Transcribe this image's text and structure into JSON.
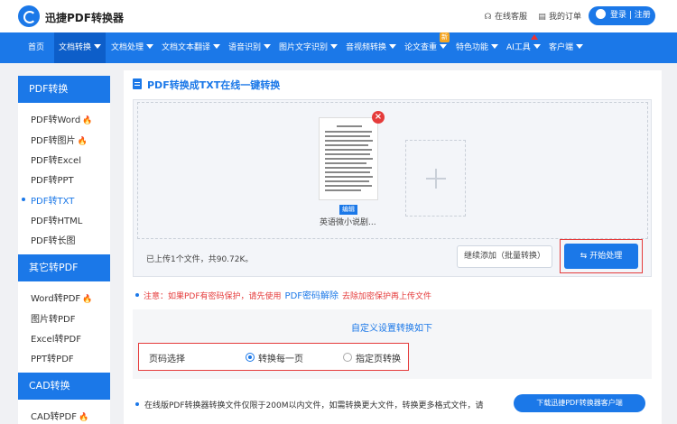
{
  "header": {
    "brand": "迅捷PDF转换器",
    "service_label": "在线客服",
    "orders_label": "我的订单",
    "login_label": "登录 | 注册"
  },
  "nav": {
    "items": [
      {
        "label": "首页"
      },
      {
        "label": "文档转换"
      },
      {
        "label": "文档处理"
      },
      {
        "label": "文档文本翻译"
      },
      {
        "label": "语音识别"
      },
      {
        "label": "图片文字识别"
      },
      {
        "label": "音视频转换"
      },
      {
        "label": "论文查重"
      },
      {
        "label": "特色功能"
      },
      {
        "label": "AI工具"
      },
      {
        "label": "客户端"
      }
    ],
    "new_badge": "新"
  },
  "sidebar": {
    "sections": [
      {
        "title": "PDF转换",
        "items": [
          "PDF转Word",
          "PDF转图片",
          "PDF转Excel",
          "PDF转PPT",
          "PDF转TXT",
          "PDF转HTML",
          "PDF转长图"
        ]
      },
      {
        "title": "其它转PDF",
        "items": [
          "Word转PDF",
          "图片转PDF",
          "Excel转PDF",
          "PPT转PDF"
        ]
      },
      {
        "title": "CAD转换",
        "items": [
          "CAD转PDF"
        ]
      }
    ]
  },
  "main": {
    "title": "PDF转换成TXT在线一键转换",
    "file": {
      "name": "英语微小说剧...",
      "edit_label": "编辑"
    },
    "upload_info": "已上传1个文件，共90.72K。",
    "add_more_label": "继续添加（批量转换）",
    "start_label": "开始处理",
    "note": {
      "prefix": "注意：如果PDF有密码保护，请先使用",
      "link": "PDF密码解除",
      "suffix": "去除加密保护再上传文件"
    },
    "settings": {
      "title": "自定义设置转换如下",
      "page_label": "页码选择",
      "option1": "转换每一页",
      "option2": "指定页转换"
    },
    "bottom_text": "在线版PDF转换器转换文件仅限于200M以内文件，如需转换更大文件，转换更多格式文件，请",
    "download_label": "下载迅捷PDF转换器客户端"
  }
}
